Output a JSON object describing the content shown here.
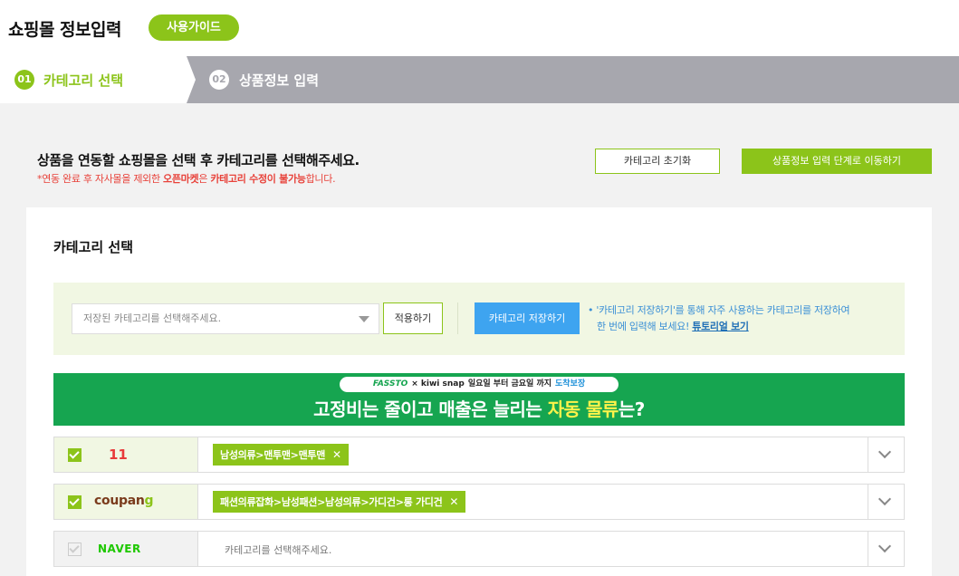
{
  "header": {
    "title": "쇼핑몰 정보입력",
    "guide_label": "사용가이드"
  },
  "steps": [
    {
      "num": "01",
      "label": "카테고리 선택"
    },
    {
      "num": "02",
      "label": "상품정보 입력"
    }
  ],
  "instruction": {
    "title": "상품을 연동할 쇼핑몰을 선택 후 카테고리를 선택해주세요.",
    "note_pre": "*연동 완료 후 자사몰을 제외한 ",
    "note_bold1": "오픈마켓",
    "note_mid": "은 ",
    "note_bold2": "카테고리 수정이 불가능",
    "note_post": "합니다.",
    "reset_label": "카테고리 초기화",
    "next_label": "상품정보 입력 단계로 이동하기"
  },
  "card": {
    "title": "카테고리 선택",
    "saved": {
      "placeholder": "저장된 카테고리를 선택해주세요.",
      "apply_label": "적용하기",
      "save_label": "카테고리 저장하기",
      "info_line1": "• '카테고리 저장하기'를 통해 자주 사용하는 카테고리를 저장하여",
      "info_line2_pre": "한 번에 입력해 보세요! ",
      "info_link": "튜토리얼 보기"
    },
    "banner": {
      "pill_logo": "FASSTO",
      "pill_x": "×",
      "pill_kiwi": "kiwi snap",
      "pill_text": "일요일 부터 금요일 까지",
      "pill_badge": "도착보장",
      "text_pre": "고정비는 줄이고 매출은 늘리는 ",
      "text_highlight": "자동 물류",
      "text_post": "는?"
    },
    "markets": [
      {
        "name": "11번가",
        "logo": "11",
        "checked": true,
        "category": "남성의류>맨투맨>맨투맨",
        "remove": "✕"
      },
      {
        "name": "coupang",
        "logo": "coupang",
        "checked": true,
        "category": "패션의류잡화>남성패션>남성의류>가디건>롱 가디건",
        "remove": "✕"
      },
      {
        "name": "NAVER",
        "logo": "NAVER",
        "checked": false,
        "placeholder": "카테고리를 선택해주세요."
      }
    ]
  },
  "colors": {
    "accent": "#8cc41a",
    "blue": "#3ea4f0",
    "banner": "#16a550",
    "warning": "#e8423a"
  }
}
